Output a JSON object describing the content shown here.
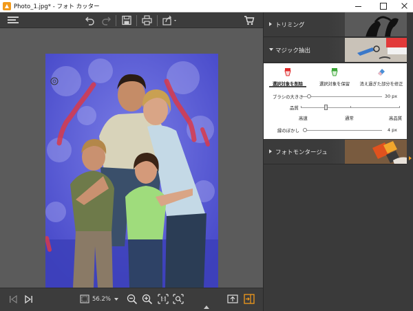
{
  "window": {
    "title": "Photo_1.jpg* - フォト カッター"
  },
  "toolbar": {
    "menu_icon": "hamburger-menu-icon",
    "undo_icon": "undo-icon",
    "redo_icon": "redo-icon",
    "save_icon": "save-icon",
    "print_icon": "print-icon",
    "share_icon": "share-icon",
    "cart_icon": "cart-icon"
  },
  "zoom": {
    "value": "56.2%"
  },
  "panel": {
    "sections": [
      {
        "label": "トリミング",
        "expanded": false
      },
      {
        "label": "マジック抽出",
        "expanded": true
      },
      {
        "label": "フォトモンタージュ",
        "expanded": false
      }
    ],
    "magic": {
      "tools": [
        {
          "label": "選択対象を削除",
          "icon": "eraser-red-icon",
          "color": "#e02a2a",
          "active": true
        },
        {
          "label": "選択対象を保留",
          "icon": "marker-green-icon",
          "color": "#3aa536",
          "active": false
        },
        {
          "label": "消え過ぎた部分を修正",
          "icon": "eraser-blue-icon",
          "color": "#4a8fd6",
          "active": false
        }
      ],
      "brush_size_label": "ブラシの大きさ",
      "brush_size_value": "30 px",
      "brush_size_level": 0.08,
      "quality_label": "品質",
      "quality_options": [
        "高速",
        "通常",
        "高品質"
      ],
      "quality_level": 0.25,
      "edge_blur_label": "縁のぼかし",
      "edge_blur_value": "4 px",
      "edge_blur_level": 0.0
    }
  },
  "colors": {
    "accent": "#f29a1b",
    "dark_bg": "#3c3c3c",
    "canvas_bg": "#5b5b5b",
    "mask_blue": "#5a5ce0",
    "stroke_red": "#d83a4a"
  }
}
